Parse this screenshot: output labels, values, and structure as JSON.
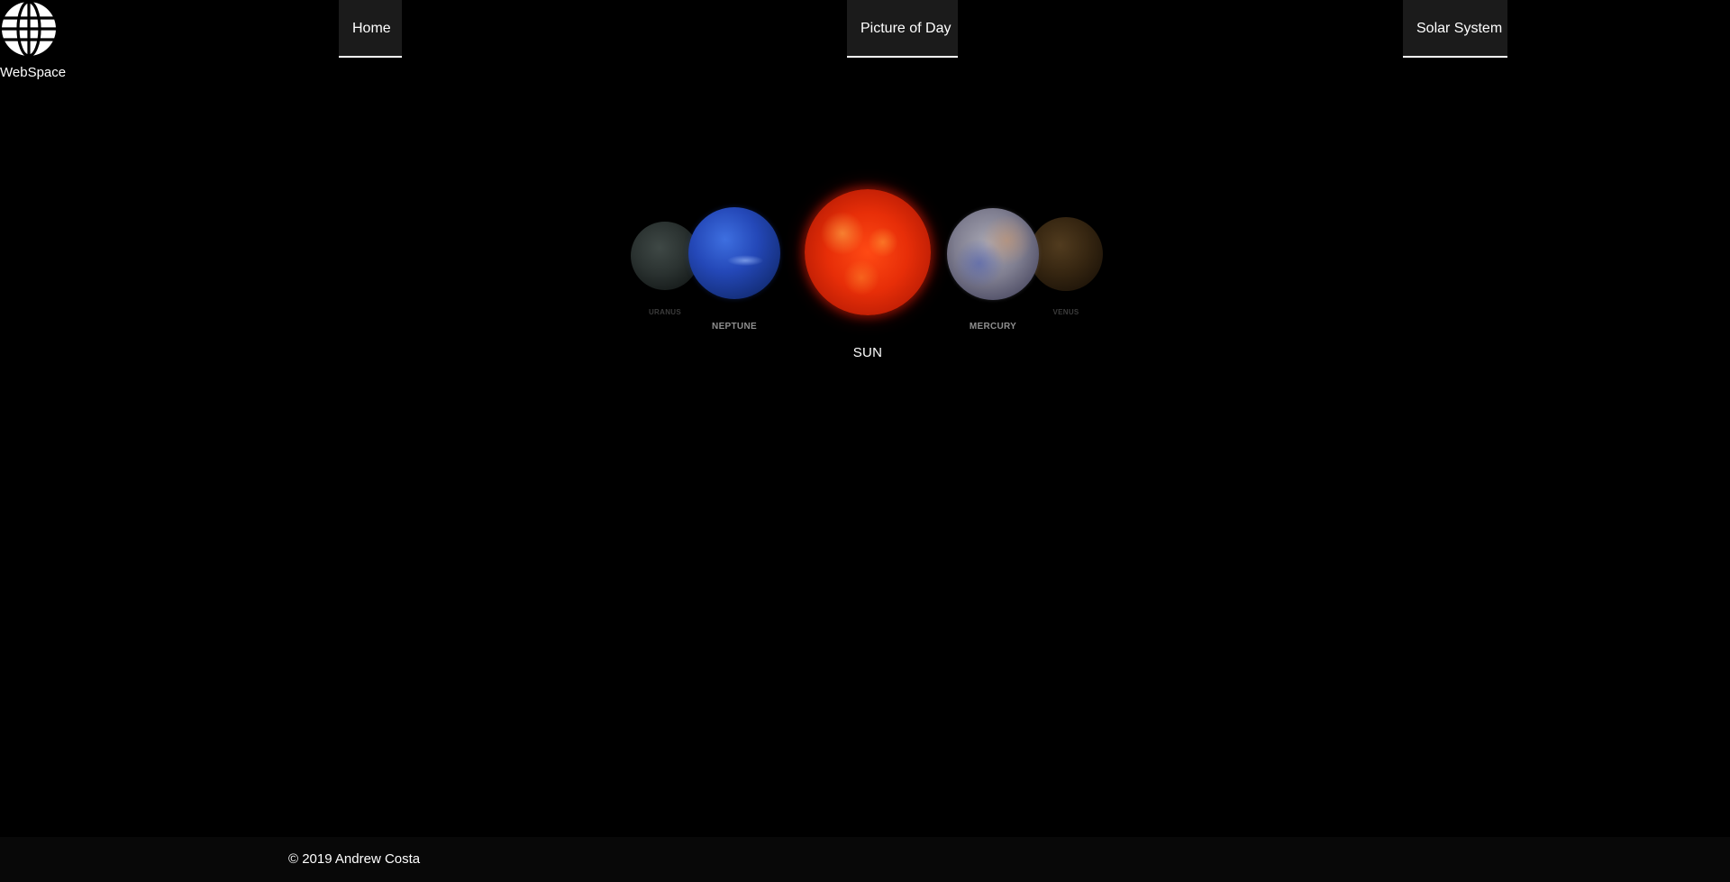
{
  "brand": {
    "name": "WebSpace",
    "icon": "globe-icon"
  },
  "nav": {
    "items": [
      {
        "label": "Home"
      },
      {
        "label": "Picture of Day"
      },
      {
        "label": "Solar System"
      }
    ]
  },
  "carousel": {
    "planets": [
      {
        "name": "URANUS",
        "color": "#323b39"
      },
      {
        "name": "NEPTUNE",
        "color": "#2448b8"
      },
      {
        "name": "SUN",
        "color": "#e72e08"
      },
      {
        "name": "MERCURY",
        "color": "#7f7e90"
      },
      {
        "name": "VENUS",
        "color": "#3c2a13"
      }
    ],
    "selected": "SUN"
  },
  "footer": {
    "copyright": "© 2019 Andrew Costa"
  },
  "colors": {
    "background": "#000000",
    "nav_bg": "#1b1b1b",
    "footer_bg": "#080808",
    "text": "#ffffff"
  }
}
